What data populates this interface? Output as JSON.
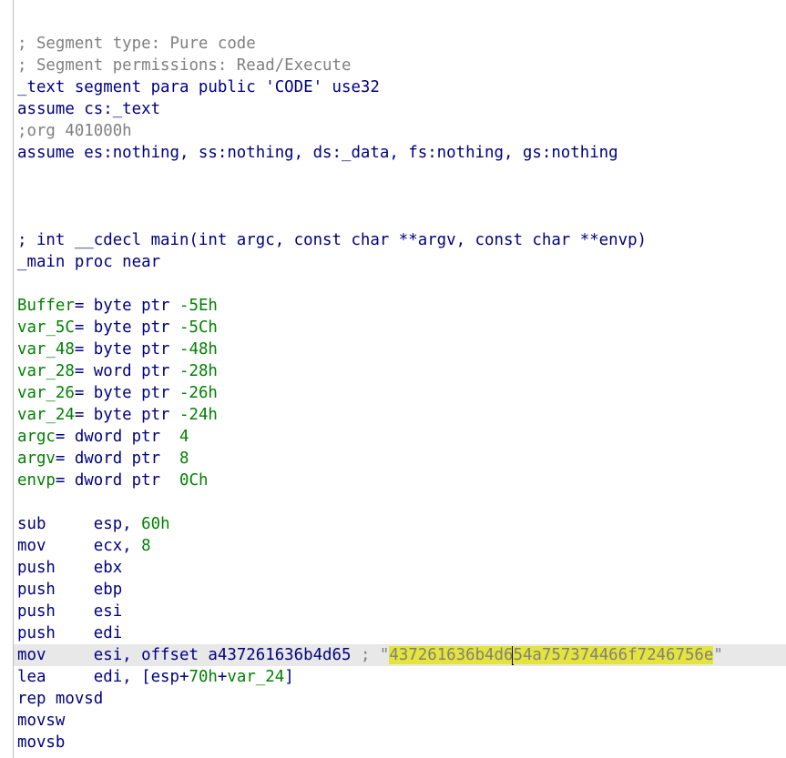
{
  "listing": {
    "header": {
      "comment_type": "; Segment type: Pure code",
      "comment_perm": "; Segment permissions: Read/Execute",
      "segment": "_text segment para public 'CODE' use32",
      "assume_cs": "assume cs:_text",
      "org": ";org 401000h",
      "assume_all": "assume es:nothing, ss:nothing, ds:_data, fs:nothing, gs:nothing"
    },
    "func": {
      "signature": "; int __cdecl main(int argc, const char **argv, const char **envp)",
      "proc": "_main proc near"
    },
    "vars": [
      {
        "name": "Buffer",
        "def": "= byte ptr ",
        "off": "-5Eh"
      },
      {
        "name": "var_5C",
        "def": "= byte ptr ",
        "off": "-5Ch"
      },
      {
        "name": "var_48",
        "def": "= byte ptr ",
        "off": "-48h"
      },
      {
        "name": "var_28",
        "def": "= word ptr ",
        "off": "-28h"
      },
      {
        "name": "var_26",
        "def": "= byte ptr ",
        "off": "-26h"
      },
      {
        "name": "var_24",
        "def": "= byte ptr ",
        "off": "-24h"
      },
      {
        "name": "argc",
        "def": "= dword ptr  ",
        "off": "4"
      },
      {
        "name": "argv",
        "def": "= dword ptr  ",
        "off": "8"
      },
      {
        "name": "envp",
        "def": "= dword ptr  ",
        "off": "0Ch"
      }
    ],
    "code": {
      "i0": {
        "mn": "sub     ",
        "op": "esp, ",
        "imm": "60h"
      },
      "i1": {
        "mn": "mov     ",
        "op": "ecx, ",
        "imm": "8"
      },
      "i2": {
        "mn": "push    ",
        "op": "ebx"
      },
      "i3": {
        "mn": "push    ",
        "op": "ebp"
      },
      "i4": {
        "mn": "push    ",
        "op": "esi"
      },
      "i5": {
        "mn": "push    ",
        "op": "edi"
      },
      "i6": {
        "mn": "mov     ",
        "op": "esi, offset a437261636b4d65",
        "cmt_prefix": " ; \"",
        "str_a": "437261636b4d6",
        "str_b": "54a757374466f7246756e",
        "cmt_suffix": "\""
      },
      "i7": {
        "mn": "lea     ",
        "op": "edi, [esp+",
        "imm": "70h",
        "plus": "+",
        "var": "var_24",
        "close": "]"
      },
      "i8": {
        "mn": "rep movsd"
      },
      "i9": {
        "mn": "movsw"
      },
      "i10": {
        "mn": "movsb"
      }
    }
  },
  "colors": {
    "comment": "#808080",
    "keyword": "#000080",
    "number": "#008000",
    "highlight": "#e4e43c",
    "current_line": "#e8e8e8"
  }
}
